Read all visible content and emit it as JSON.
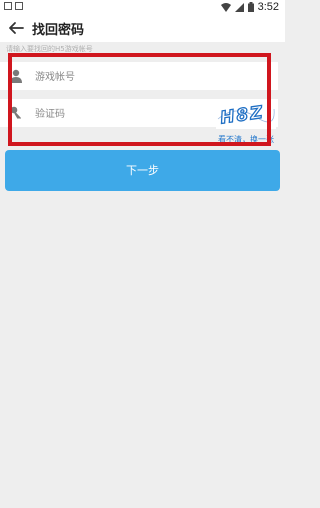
{
  "status_bar": {
    "time": "3:52"
  },
  "app_bar": {
    "title": "找回密码"
  },
  "hint": {
    "text": "请输入要找回的H5游戏帐号"
  },
  "account": {
    "placeholder": "游戏帐号",
    "icon": "user-icon"
  },
  "captcha": {
    "placeholder": "验证码",
    "icon": "key-icon",
    "image_text": "H8Z",
    "refresh_label": "看不清，换一张"
  },
  "actions": {
    "next_label": "下一步"
  },
  "colors": {
    "accent": "#3ea9e8",
    "highlight": "#d0161e",
    "link": "#2277cc"
  }
}
